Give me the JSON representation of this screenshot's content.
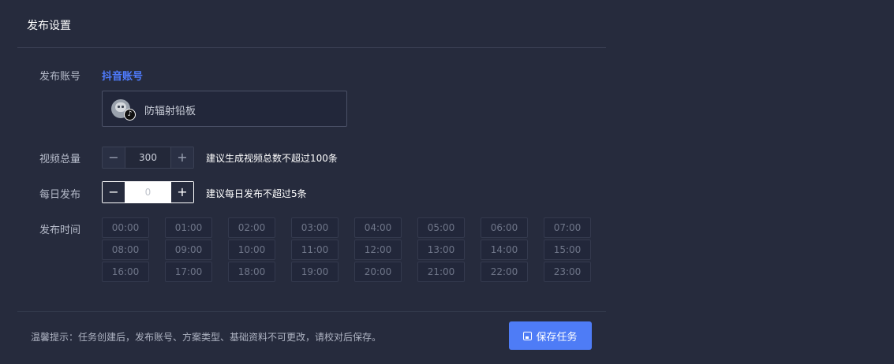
{
  "section_title": "发布设置",
  "account": {
    "label": "发布账号",
    "platform_link": "抖音账号",
    "name": "防辐射铅板",
    "avatar_icon": "robot-avatar-icon",
    "badge_icon": "tiktok-icon",
    "badge_glyph": "♪"
  },
  "video_total": {
    "label": "视频总量",
    "minus": "−",
    "value": "300",
    "plus": "+",
    "hint": "建议生成视频总数不超过100条"
  },
  "daily_publish": {
    "label": "每日发布",
    "minus": "−",
    "value": "0",
    "plus": "+",
    "hint": "建议每日发布不超过5条"
  },
  "publish_time": {
    "label": "发布时间",
    "slots": [
      "00:00",
      "01:00",
      "02:00",
      "03:00",
      "04:00",
      "05:00",
      "06:00",
      "07:00",
      "08:00",
      "09:00",
      "10:00",
      "11:00",
      "12:00",
      "13:00",
      "14:00",
      "15:00",
      "16:00",
      "17:00",
      "18:00",
      "19:00",
      "20:00",
      "21:00",
      "22:00",
      "23:00"
    ]
  },
  "footer": {
    "tip": "温馨提示：任务创建后，发布账号、方案类型、基础资料不可更改，请校对后保存。",
    "save_label": "保存任务",
    "save_icon": "save-icon"
  },
  "colors": {
    "background": "#262b3d",
    "accent": "#4e7cf6",
    "link": "#4f7cff"
  }
}
